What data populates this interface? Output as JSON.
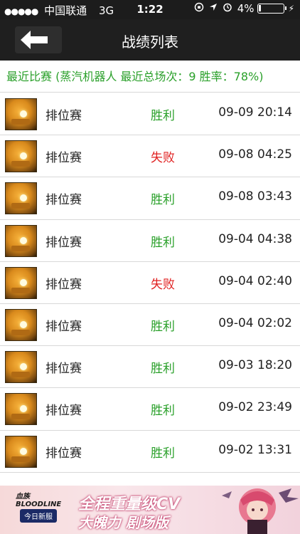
{
  "status_bar": {
    "signal_dots": "●●●●●",
    "carrier": "中国联通",
    "network": "3G",
    "time": "1:22",
    "battery": "4%"
  },
  "nav": {
    "title": "战绩列表"
  },
  "summary": {
    "text": "最近比赛 (蒸汽机器人 最近总场次：9 胜率：78%)"
  },
  "matches": [
    {
      "mode": "排位赛",
      "result": "胜利",
      "outcome": "win",
      "time": "09-09 20:14"
    },
    {
      "mode": "排位赛",
      "result": "失败",
      "outcome": "loss",
      "time": "09-08 04:25"
    },
    {
      "mode": "排位赛",
      "result": "胜利",
      "outcome": "win",
      "time": "09-08 03:43"
    },
    {
      "mode": "排位赛",
      "result": "胜利",
      "outcome": "win",
      "time": "09-04 04:38"
    },
    {
      "mode": "排位赛",
      "result": "失败",
      "outcome": "loss",
      "time": "09-04 02:40"
    },
    {
      "mode": "排位赛",
      "result": "胜利",
      "outcome": "win",
      "time": "09-04 02:02"
    },
    {
      "mode": "排位赛",
      "result": "胜利",
      "outcome": "win",
      "time": "09-03 18:20"
    },
    {
      "mode": "排位赛",
      "result": "胜利",
      "outcome": "win",
      "time": "09-02 23:49"
    },
    {
      "mode": "排位赛",
      "result": "胜利",
      "outcome": "win",
      "time": "09-02 13:31"
    }
  ],
  "banner": {
    "logo": "血族 BLOODLINE",
    "tag": "今日新服",
    "line1": "全程重量级CV",
    "line2": "大魄力 剧场版"
  },
  "colors": {
    "win": "#2aa02a",
    "loss": "#e02020",
    "navbar": "#1f1f1f"
  }
}
